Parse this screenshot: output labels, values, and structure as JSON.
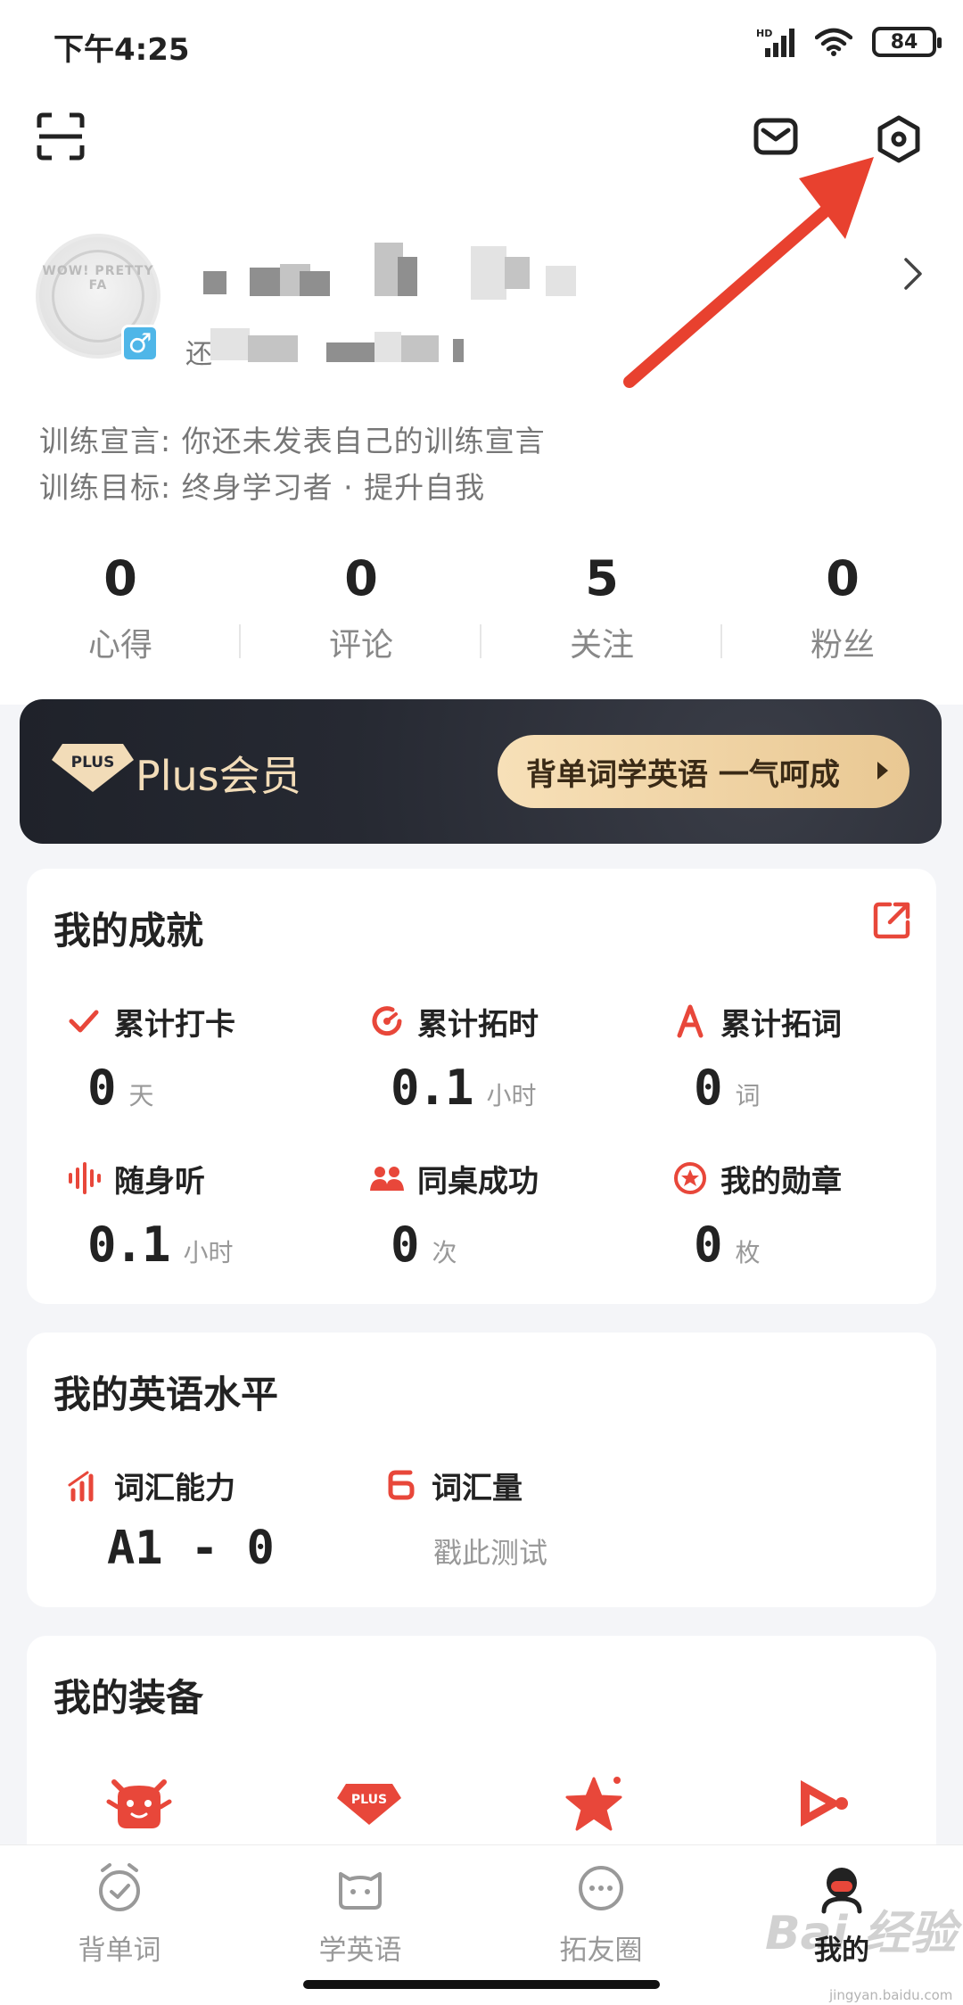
{
  "status_bar": {
    "time": "下午4:25",
    "network": "HD",
    "battery": "84"
  },
  "header": {
    "scan_icon": "scan-icon",
    "mail_icon": "mail-icon",
    "settings_icon": "settings-icon"
  },
  "annotation": {
    "arrow_color": "#e8412f"
  },
  "profile": {
    "name_prefix": "还",
    "gender": "♂",
    "avatar_text": "WOW! PRETTY FA",
    "declaration": "训练宣言: 你还未发表自己的训练宣言",
    "goal": "训练目标: 终身学习者 · 提升自我"
  },
  "stats": [
    {
      "value": "0",
      "label": "心得"
    },
    {
      "value": "0",
      "label": "评论"
    },
    {
      "value": "5",
      "label": "关注"
    },
    {
      "value": "0",
      "label": "粉丝"
    }
  ],
  "plus": {
    "badge": "PLUS",
    "title": "Plus会员",
    "cta": "背单词学英语 一气呵成"
  },
  "achievements": {
    "title": "我的成就",
    "items": [
      {
        "label": "累计打卡",
        "value": "0",
        "unit": "天"
      },
      {
        "label": "累计拓时",
        "value": "0.1",
        "unit": "小时"
      },
      {
        "label": "累计拓词",
        "value": "0",
        "unit": "词"
      },
      {
        "label": "随身听",
        "value": "0.1",
        "unit": "小时"
      },
      {
        "label": "同桌成功",
        "value": "0",
        "unit": "次"
      },
      {
        "label": "我的勋章",
        "value": "0",
        "unit": "枚"
      }
    ]
  },
  "level": {
    "title": "我的英语水平",
    "vocab_ability_label": "词汇能力",
    "vocab_ability_value": "A1 - 0",
    "vocab_size_label": "词汇量",
    "vocab_size_link": "戳此测试"
  },
  "equipment": {
    "title": "我的装备",
    "plus_badge": "PLUS"
  },
  "bottom_nav": [
    {
      "label": "背单词"
    },
    {
      "label": "学英语"
    },
    {
      "label": "拓友圈"
    },
    {
      "label": "我的"
    }
  ],
  "colors": {
    "accent": "#e8473a",
    "plus_gold": "#f2dcb8",
    "banner_dark": "#262932"
  },
  "watermark": {
    "main": "Bai 经验",
    "sub": "jingyan.baidu.com"
  }
}
